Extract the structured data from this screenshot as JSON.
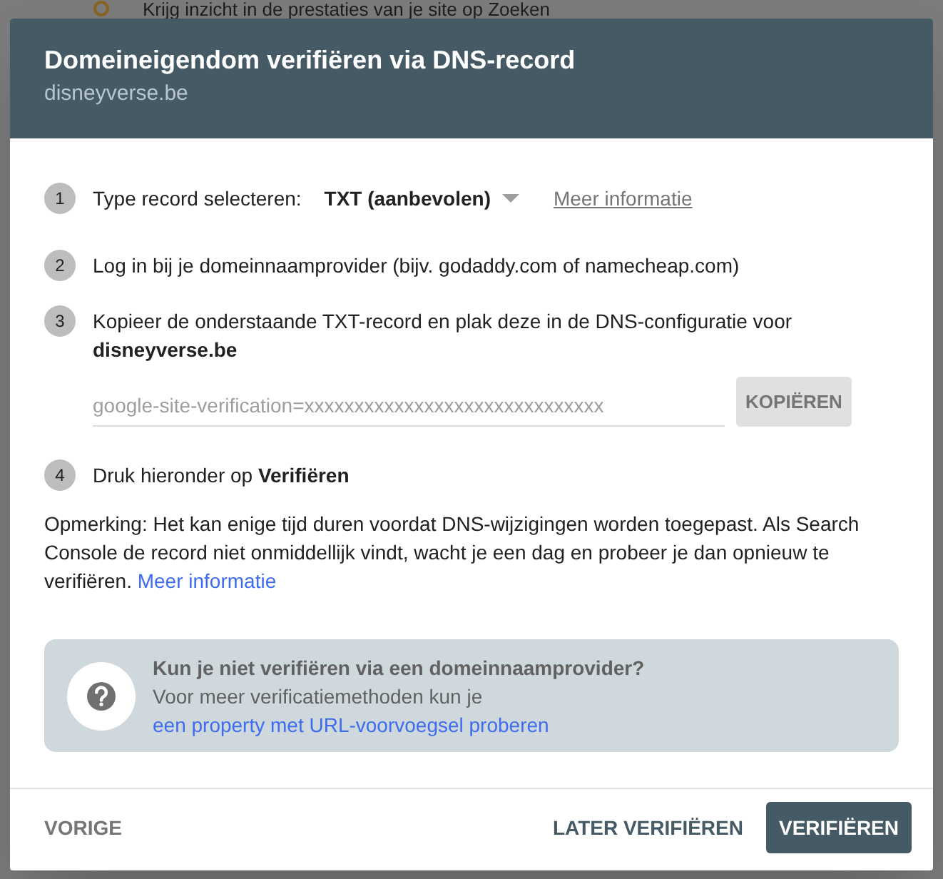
{
  "background_page": {
    "heading": "Krijg inzicht in de prestaties van je site op Zoeken"
  },
  "dialog": {
    "title": "Domeineigendom verifiëren via DNS-record",
    "subtitle": "disneyverse.be"
  },
  "steps": [
    {
      "number": "1",
      "kind": "select",
      "label": "Type record selecteren:",
      "select": {
        "value": "TXT (aanbevolen)"
      },
      "link": "Meer informatie"
    },
    {
      "number": "2",
      "kind": "text",
      "text": "Log in bij je domeinnaamprovider (bijv. godaddy.com of namecheap.com)"
    },
    {
      "number": "3",
      "kind": "copy",
      "text": "Kopieer de onderstaande TXT-record en plak deze in de DNS-configuratie voor **disneyverse.be**",
      "field": {
        "value": "google-site-verification=xxxxxxxxxxxxxxxxxxxxxxxxxxxxxx"
      },
      "button": "KOPIËREN"
    },
    {
      "number": "4",
      "kind": "text",
      "text": "Druk hieronder op **Verifiëren**"
    }
  ],
  "note": {
    "text": "Opmerking: Het kan enige tijd duren voordat DNS-wijzigingen worden toegepast. Als Search Console de record niet onmiddellijk vindt, wacht je een dag en probeer je dan opnieuw te verifiëren.",
    "link": "Meer informatie"
  },
  "info_box": {
    "title": "Kun je niet verifiëren via een domeinnaamprovider?",
    "text": "Voor meer verificatiemethoden kun je",
    "link": "een property met URL-voorvoegsel proberen"
  },
  "footer": {
    "buttons": [
      {
        "label": "VORIGE",
        "kind": "back"
      },
      {
        "label": "LATER VERIFIËREN",
        "kind": "secondary"
      },
      {
        "label": "VERIFIËREN",
        "kind": "primary"
      }
    ]
  }
}
